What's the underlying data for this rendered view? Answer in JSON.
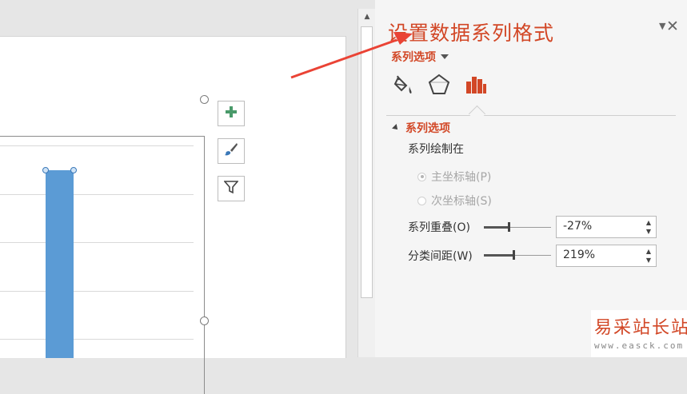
{
  "panel": {
    "title": "设置数据系列格式",
    "series_options_link": "系列选项",
    "section_title": "系列选项",
    "plot_on_label": "系列绘制在",
    "primary_axis_label": "主坐标轴(P)",
    "secondary_axis_label": "次坐标轴(S)",
    "primary_axis_selected": true,
    "overlap_label": "系列重叠(O)",
    "overlap_value": "-27%",
    "overlap_fraction": 0.365,
    "gap_label": "分类间距(W)",
    "gap_value": "219%",
    "gap_fraction": 0.44,
    "accent_color": "#d24726"
  },
  "icons": {
    "fill": "paint-bucket-icon",
    "effects": "pentagon-icon",
    "series_options": "bar-chart-icon",
    "add": "plus-icon",
    "style": "brush-icon",
    "filter": "funnel-icon",
    "close": "close-icon",
    "dropdown": "chevron-down-icon"
  },
  "chart": {
    "bar_color": "#5b9bd5"
  },
  "watermark": {
    "main": "易采站长站",
    "sub": "www.easck.com"
  }
}
